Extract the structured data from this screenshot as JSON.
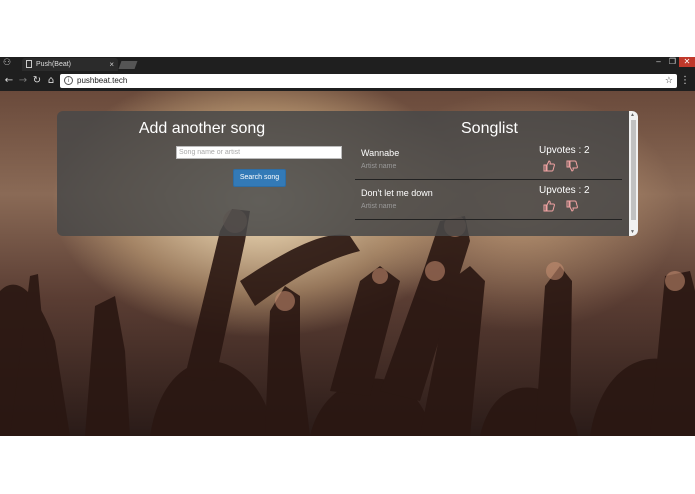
{
  "browser": {
    "tab_title": "Push(Beat)",
    "tab_close": "×",
    "url": "pushbeat.tech",
    "window_controls": {
      "minimize": "–",
      "maximize": "❐",
      "close": "✕"
    },
    "nav": {
      "back": "←",
      "forward": "→",
      "reload": "↻",
      "home": "⌂"
    },
    "star": "☆",
    "menu": "⋮",
    "info": "i"
  },
  "add_song": {
    "title": "Add another song",
    "input_placeholder": "Song name or artist",
    "input_value": "",
    "button_label": "Search song"
  },
  "songlist": {
    "title": "Songlist",
    "songs": [
      {
        "name": "Wannabe",
        "artist": "Artist name",
        "votes": "Upvotes : 2"
      },
      {
        "name": "Don't let me down",
        "artist": "Artist name",
        "votes": "Upvotes : 2"
      }
    ]
  },
  "colors": {
    "accent": "#337ab7",
    "thumb": "#f2a3a3"
  },
  "icons": {
    "upvote": "thumbs-up-icon",
    "downvote": "thumbs-down-icon"
  }
}
